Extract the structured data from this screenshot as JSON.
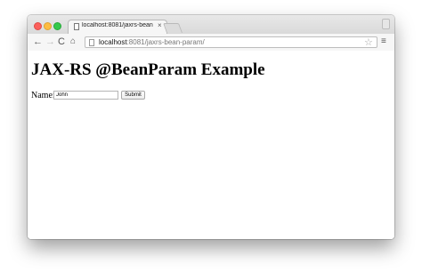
{
  "browser": {
    "tab": {
      "title": "localhost:8081/jaxrs-bean-",
      "close_glyph": "×"
    },
    "toolbar": {
      "back_glyph": "←",
      "forward_glyph": "→",
      "reload_glyph": "C",
      "home_glyph": "⌂",
      "star_glyph": "☆",
      "menu_glyph": "≡"
    },
    "address": {
      "host": "localhost",
      "rest": ":8081/jaxrs-bean-param/"
    },
    "traffic_lights": {
      "close": "#fc605c",
      "minimize": "#fdbc40",
      "zoom": "#34c84a"
    }
  },
  "page": {
    "heading": "JAX-RS @BeanParam Example",
    "form": {
      "label": "Name:",
      "input_value": "John",
      "submit_label": "Submit"
    }
  }
}
